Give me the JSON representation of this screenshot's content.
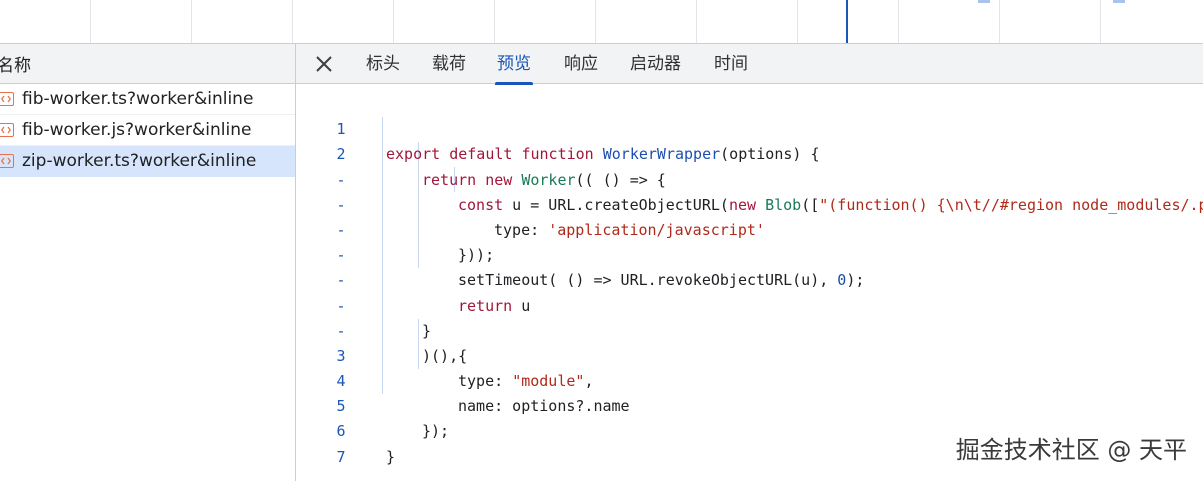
{
  "left_panel": {
    "header": "名称",
    "requests": [
      {
        "name": "fib-worker.ts?worker&inline",
        "selected": false
      },
      {
        "name": "fib-worker.js?worker&inline",
        "selected": false
      },
      {
        "name": "zip-worker.ts?worker&inline",
        "selected": true
      }
    ]
  },
  "tabs": {
    "items": [
      "标头",
      "载荷",
      "预览",
      "响应",
      "启动器",
      "时间"
    ],
    "active": "预览"
  },
  "code": {
    "line_numbers": [
      "1",
      "2",
      "-",
      "-",
      "-",
      "-",
      "-",
      "-",
      "-",
      "3",
      "4",
      "5",
      "6",
      "7"
    ],
    "lines": [
      [
        "export",
        " ",
        "default",
        " ",
        "function",
        " ",
        "WorkerWrapper",
        "(options) {"
      ],
      [
        "return",
        " ",
        "new",
        " ",
        "Worker",
        "(( () => {"
      ],
      [
        "const",
        " u = URL.createObjectURL(",
        "new",
        " ",
        "Blob",
        "([",
        "\"(function() {\\n\\t//#region node_modules/.p"
      ],
      [
        "type: ",
        "'application/javascript'"
      ],
      [
        "}));"
      ],
      [
        "setTimeout( () => URL.revokeObjectURL(u), ",
        "0",
        ");"
      ],
      [
        "return",
        " u"
      ],
      [
        "}"
      ],
      [
        ")(),{"
      ],
      [
        "type: ",
        "\"module\"",
        ","
      ],
      [
        "name: options?.name"
      ],
      [
        "});"
      ],
      [
        "}"
      ],
      [
        ""
      ]
    ]
  },
  "watermark": "掘金技术社区 @ 天平",
  "colors": {
    "accent": "#1a56b8",
    "selected_row": "#d6e5fb",
    "file_icon": "#e8734a"
  }
}
